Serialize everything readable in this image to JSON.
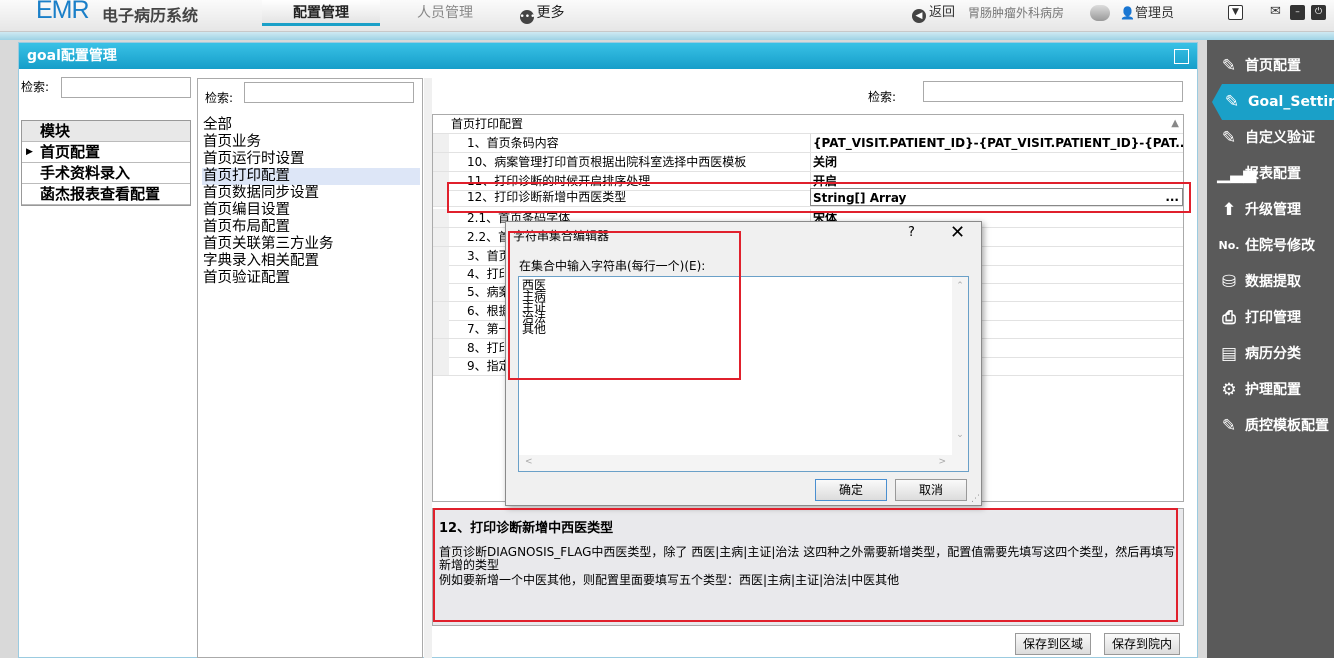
{
  "app": {
    "brand": "EMR",
    "title": "电子病历系统"
  },
  "topnav": {
    "config": "配置管理",
    "people": "人员管理",
    "more": "更多"
  },
  "toolbar": {
    "back": "返回",
    "ward": "胃肠肿瘤外科病房",
    "user": "管理员"
  },
  "panel": {
    "title": "goal配置管理"
  },
  "search": {
    "label": "检索:",
    "value": ""
  },
  "modules": {
    "header": "模块",
    "items": [
      "首页配置",
      "手术资料录入",
      "菡杰报表查看配置"
    ]
  },
  "categories": [
    "全部",
    "首页业务",
    "首页运行时设置",
    "首页打印配置",
    "首页数据同步设置",
    "首页编目设置",
    "首页布局配置",
    "首页关联第三方业务",
    "字典录入相关配置",
    "首页验证配置"
  ],
  "propgrid": {
    "category": "首页打印配置",
    "rows": [
      {
        "name": "1、首页条码内容",
        "value": "{PAT_VISIT.PATIENT_ID}-{PAT_VISIT.PATIENT_ID}-{PAT..."
      },
      {
        "name": "10、病案管理打印首页根据出院科室选择中西医模板",
        "value": "关闭"
      },
      {
        "name": "11、打印诊断的时候开启排序处理",
        "value": "开启"
      },
      {
        "name": "12、打印诊断新增中西医类型",
        "value": "String[] Array"
      },
      {
        "name": "2.1、首页条码字体",
        "value": "宋体"
      },
      {
        "name": "2.2、首页条码字号",
        "value": ""
      },
      {
        "name": "3、首页",
        "value": ""
      },
      {
        "name": "4、打印",
        "value": ""
      },
      {
        "name": "5、病案",
        "value": ""
      },
      {
        "name": "6、根据",
        "value": ""
      },
      {
        "name": "7、第一",
        "value": ""
      },
      {
        "name": "8、打印",
        "value": ""
      },
      {
        "name": "9、指定",
        "value": ""
      }
    ],
    "ellipsis": "..."
  },
  "description": {
    "title": "12、打印诊断新增中西医类型",
    "line1": "首页诊断DIAGNOSIS_FLAG中西医类型，除了 西医|主病|主证|治法 这四种之外需要新增类型，配置值需要先填写这四个类型，然后再填写新增的类型",
    "line2": " 例如要新增一个中医其他，则配置里面要填写五个类型：西医|主病|主证|治法|中医其他"
  },
  "buttons": {
    "save_region": "保存到区域",
    "save_hospital": "保存到院内"
  },
  "sidebar": [
    {
      "label": "首页配置",
      "icon": "edit-pen-icon"
    },
    {
      "label": "Goal_Settin",
      "icon": "edit-pen-icon"
    },
    {
      "label": "自定义验证",
      "icon": "edit-pen-icon"
    },
    {
      "label": "报表配置",
      "icon": "bar-chart-icon"
    },
    {
      "label": "升级管理",
      "icon": "upgrade-arrow-icon"
    },
    {
      "label": "住院号修改",
      "icon": "number-icon"
    },
    {
      "label": "数据提取",
      "icon": "database-icon"
    },
    {
      "label": "打印管理",
      "icon": "printer-icon"
    },
    {
      "label": "病历分类",
      "icon": "category-icon"
    },
    {
      "label": "护理配置",
      "icon": "nurse-icon"
    },
    {
      "label": "质控模板配置",
      "icon": "edit-pen-icon"
    }
  ],
  "dialog": {
    "title": "字符串集合编辑器",
    "help": "?",
    "close": "✕",
    "prompt": "在集合中输入字符串(每行一个)(E):",
    "lines": [
      "西医",
      "主病",
      "主证",
      "治法",
      "其他"
    ],
    "ok": "确定",
    "cancel": "取消"
  },
  "colors": {
    "accent": "#1aa0c8",
    "highlight": "#e0202c",
    "sidebar": "#5a5a5a"
  }
}
